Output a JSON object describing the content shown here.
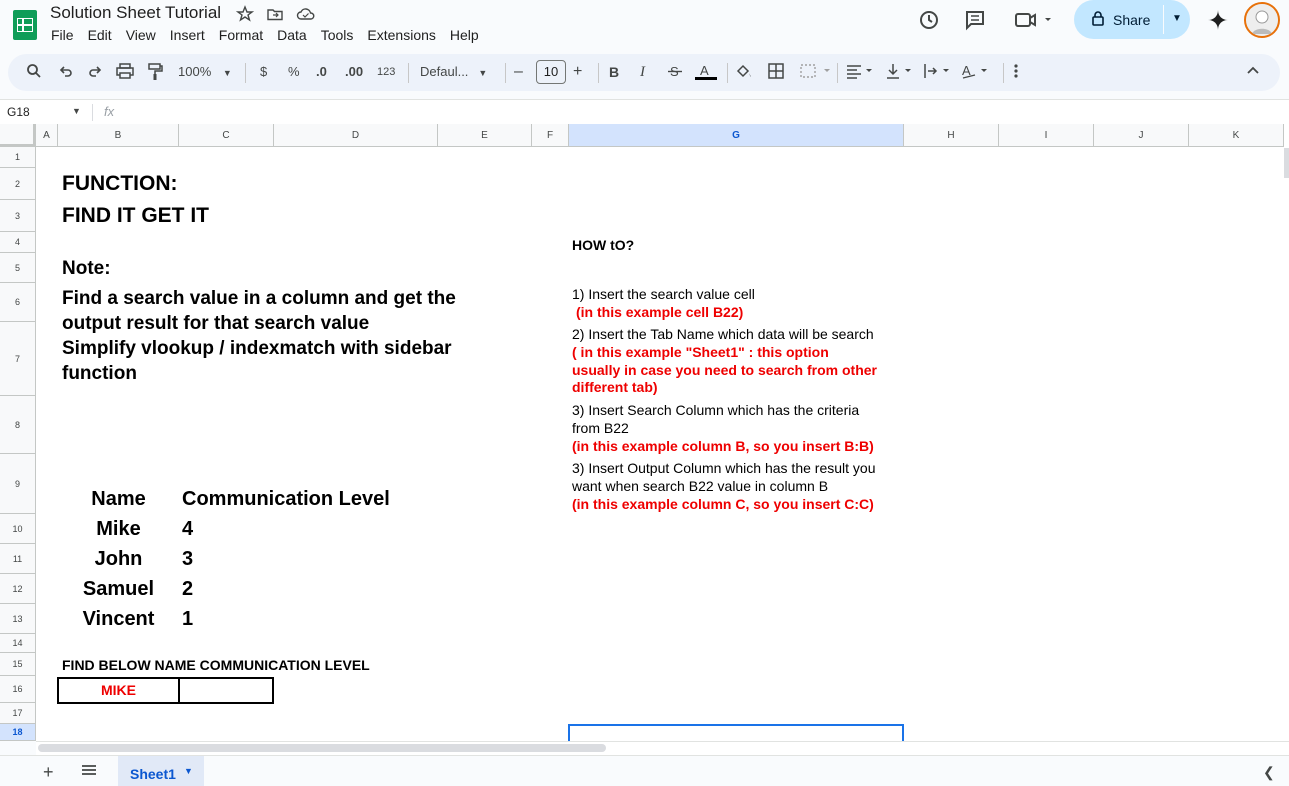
{
  "app": {
    "title": "Solution Sheet Tutorial",
    "menu": [
      "File",
      "Edit",
      "View",
      "Insert",
      "Format",
      "Data",
      "Tools",
      "Extensions",
      "Help"
    ],
    "share_label": "Share",
    "accent": "#0b57d0",
    "logo_color": "#0f9d58"
  },
  "toolbar": {
    "zoom": "100%",
    "currency": "$",
    "percent": "%",
    "dec_decrease": ".0",
    "dec_increase": ".00",
    "number_format": "123",
    "font": "Defaul...",
    "font_size": "10",
    "bold": "B",
    "italic": "I"
  },
  "formula_bar": {
    "name_box": "G18",
    "fx": "fx"
  },
  "columns": [
    "A",
    "B",
    "C",
    "D",
    "E",
    "F",
    "G",
    "H",
    "I",
    "J",
    "K"
  ],
  "selected_column": "G",
  "rows": [
    "1",
    "2",
    "3",
    "4",
    "5",
    "6",
    "7",
    "8",
    "9",
    "10",
    "11",
    "12",
    "13",
    "14",
    "15",
    "16",
    "17",
    "18"
  ],
  "selected_row": "18",
  "sheet": {
    "heading1": "FUNCTION:",
    "heading2": "FIND IT GET IT",
    "note_label": "Note:",
    "note_line1": "Find a search value in a column and get the",
    "note_line2": "output result for that search value",
    "note_line3": "Simplify vlookup / indexmatch with sidebar",
    "note_line4": "function",
    "table": {
      "header_name": "Name",
      "header_level": "Communication Level",
      "rows": [
        {
          "name": "Mike",
          "level": "4"
        },
        {
          "name": "John",
          "level": "3"
        },
        {
          "name": "Samuel",
          "level": "2"
        },
        {
          "name": "Vincent",
          "level": "1"
        }
      ]
    },
    "find_label": "FIND BELOW NAME COMMUNICATION LEVEL",
    "search_value": "MIKE",
    "howto": {
      "title": "HOW tO?",
      "step1": "1) Insert the search value cell",
      "step1_example": "(in this example cell B22)",
      "step2": "2) Insert the Tab Name which data will be search",
      "step2_example_1": "( in this example \"Sheet1\" : this option",
      "step2_example_2": "usually in case you need to search from other",
      "step2_example_3": "different tab)",
      "step3": "3) Insert Search Column which has the criteria",
      "step3_cont": "from B22",
      "step3_example": "(in this example column B, so you insert B:B)",
      "step4": "3) Insert Output Column which has the result you",
      "step4_cont": "want when search B22 value in column B",
      "step4_example": "(in this example column C, so you insert C:C)"
    }
  },
  "tabs": {
    "active": "Sheet1"
  }
}
